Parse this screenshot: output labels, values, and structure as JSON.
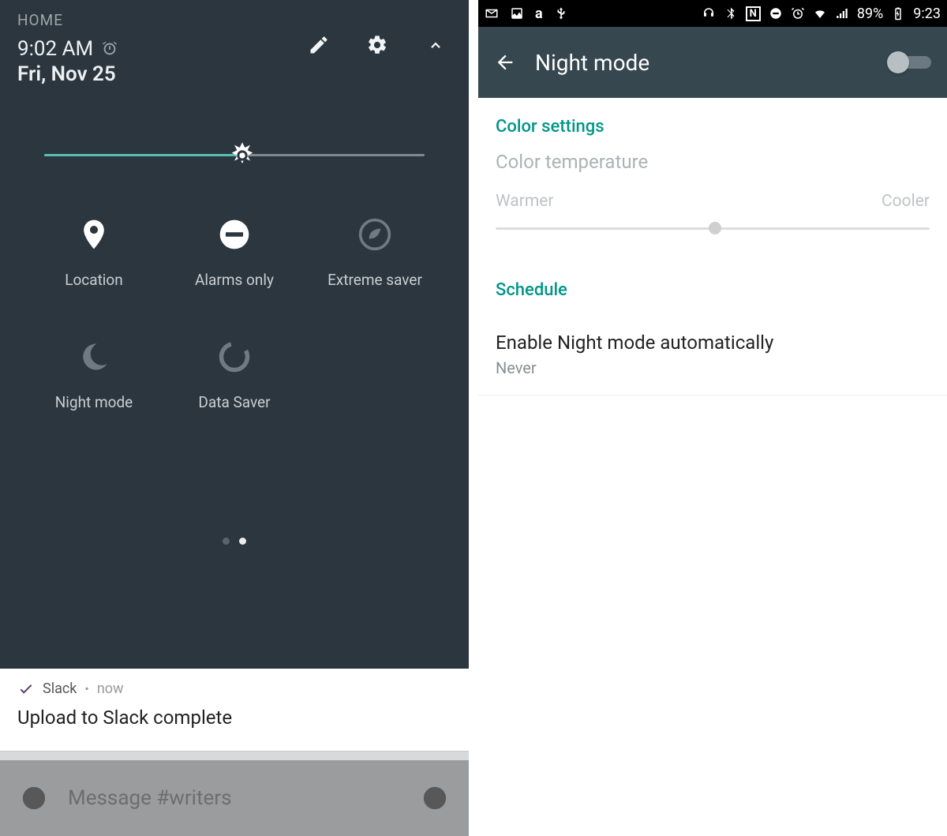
{
  "left": {
    "home_label": "HOME",
    "time": "9:02 AM",
    "date": "Fri, Nov 25",
    "brightness_percent": 52,
    "tiles": [
      {
        "label": "Location",
        "icon": "location-icon",
        "active": true
      },
      {
        "label": "Alarms only",
        "icon": "dnd-icon",
        "active": true
      },
      {
        "label": "Extreme saver",
        "icon": "leaf-icon",
        "active": false
      },
      {
        "label": "Night mode",
        "icon": "moon-icon",
        "active": false
      },
      {
        "label": "Data Saver",
        "icon": "data-saver-icon",
        "active": false
      }
    ],
    "page_indicator": {
      "count": 2,
      "active": 1
    },
    "notification": {
      "app": "Slack",
      "when": "now",
      "body": "Upload to Slack complete"
    },
    "input_placeholder": "Message #writers"
  },
  "right": {
    "status": {
      "battery_text": "89%",
      "time": "9:23"
    },
    "title": "Night mode",
    "toggle_on": false,
    "color_settings_header": "Color settings",
    "color_temperature_label": "Color temperature",
    "warmer_label": "Warmer",
    "cooler_label": "Cooler",
    "schedule_header": "Schedule",
    "schedule_item_title": "Enable Night mode automatically",
    "schedule_item_value": "Never"
  }
}
